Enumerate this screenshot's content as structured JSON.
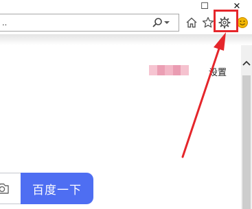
{
  "address_bar": {
    "text": ".."
  },
  "window_controls": {
    "restore_symbol": "☐",
    "close_symbol": "✕"
  },
  "page": {
    "settings_label": "设置",
    "search_button_label": "百度一下"
  },
  "colors": {
    "accent": "#4e6ef2",
    "annotation_red": "#e5262b",
    "blurred_pink": [
      "#f6c4d1",
      "#eb9fb4",
      "#f3b6c6",
      "#ea9cb2",
      "#f5c2cf"
    ]
  },
  "icons": [
    "home-icon",
    "star-icon",
    "gear-icon",
    "smiley-icon",
    "search-icon",
    "camera-icon",
    "close-icon",
    "restore-icon",
    "scroll-up-icon"
  ]
}
